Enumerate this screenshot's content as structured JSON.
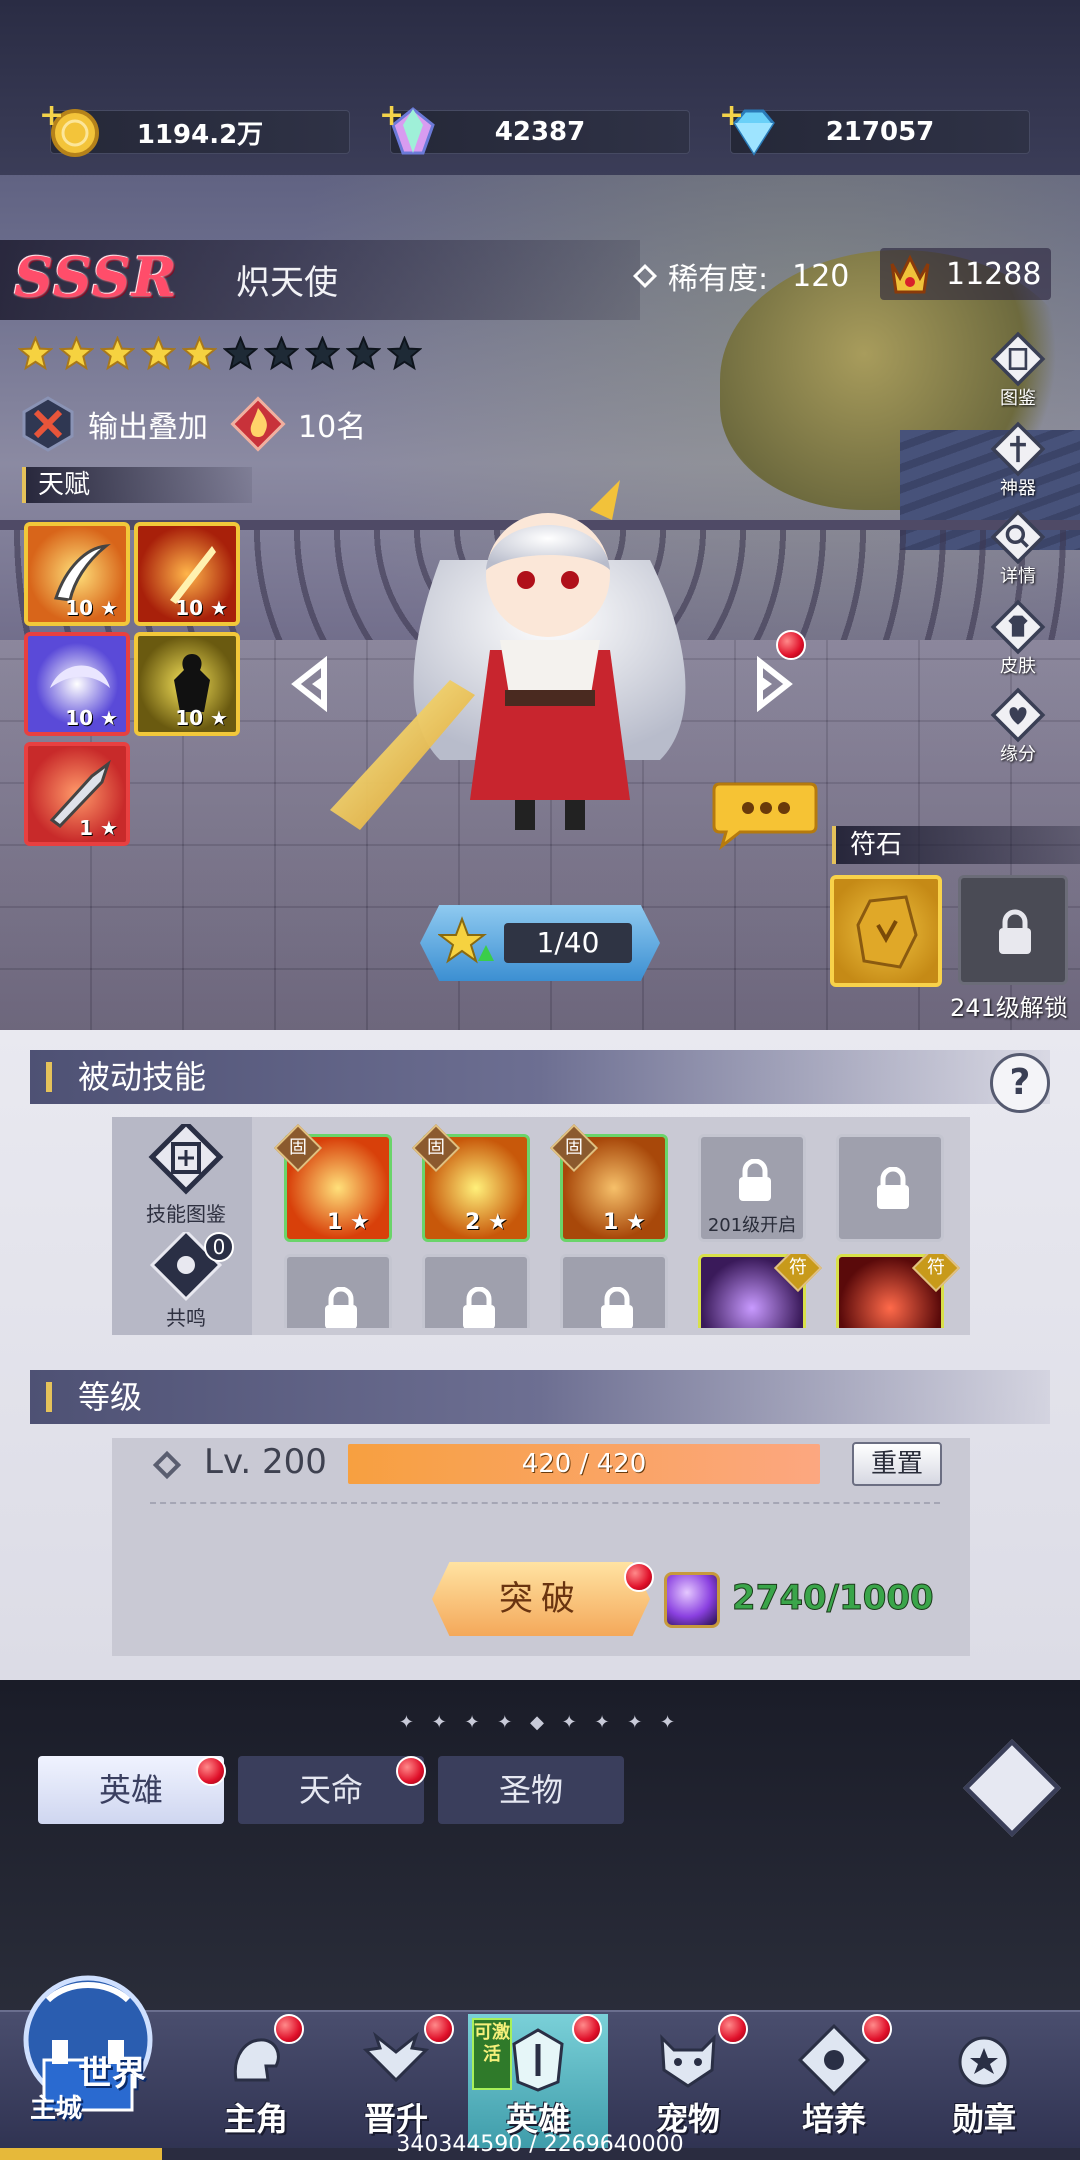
{
  "currencies": [
    {
      "name": "gold",
      "value": "1194.2万",
      "icon": "gold-coin-icon"
    },
    {
      "name": "crystal",
      "value": "42387",
      "icon": "rainbow-crystal-icon"
    },
    {
      "name": "diamond",
      "value": "217057",
      "icon": "blue-diamond-icon"
    }
  ],
  "hero": {
    "tier": "SSSR",
    "name": "炽天使",
    "rarity_label": "稀有度:",
    "rarity_value": "120",
    "power": "11288",
    "stars_filled": 5,
    "stars_total": 10,
    "tags": [
      {
        "icon": "crossed-swords-icon",
        "label": "输出叠加"
      },
      {
        "icon": "flame-icon",
        "label": "10名"
      }
    ],
    "talent_label": "天赋",
    "talents": [
      {
        "icon": "blade-talent-icon",
        "level": "10"
      },
      {
        "icon": "fire-slash-talent-icon",
        "level": "10"
      },
      {
        "icon": "swirl-talent-icon",
        "level": "10"
      },
      {
        "icon": "shadow-talent-icon",
        "level": "10"
      },
      {
        "icon": "weapon-talent-icon",
        "level": "1"
      }
    ],
    "level_progress": "1/40"
  },
  "side_menu": [
    {
      "label": "图鉴",
      "icon": "codex-icon"
    },
    {
      "label": "神器",
      "icon": "artifact-icon"
    },
    {
      "label": "详情",
      "icon": "magnifier-icon"
    },
    {
      "label": "皮肤",
      "icon": "skin-icon"
    },
    {
      "label": "缘分",
      "icon": "heart-icon"
    }
  ],
  "rune": {
    "label": "符石",
    "unlock_text": "241级解锁"
  },
  "passive": {
    "title": "被动技能",
    "codex_label": "技能图鉴",
    "resonance_label": "共鸣",
    "resonance_count": "0",
    "skills_row1": [
      {
        "state": "active",
        "badge": "固",
        "level": "1"
      },
      {
        "state": "active",
        "badge": "固",
        "level": "2"
      },
      {
        "state": "active",
        "badge": "固",
        "level": "1"
      },
      {
        "state": "locked",
        "unlock": "201级开启"
      },
      {
        "state": "locked",
        "unlock": ""
      }
    ],
    "skills_row2": [
      {
        "state": "locked"
      },
      {
        "state": "locked"
      },
      {
        "state": "locked"
      },
      {
        "state": "rune",
        "badge": "符"
      },
      {
        "state": "rune",
        "badge": "符"
      }
    ]
  },
  "level": {
    "title": "等级",
    "lv_text": "Lv. 200",
    "exp_text": "420 / 420",
    "exp_fraction": 1.0,
    "reset_label": "重置",
    "break_label": "突破",
    "orb_count": "2740/1000"
  },
  "sub_tabs": [
    {
      "label": "英雄",
      "active": true
    },
    {
      "label": "天命",
      "active": false
    },
    {
      "label": "圣物",
      "active": false
    }
  ],
  "nav": {
    "world_label": "世界",
    "home_label": "主城",
    "items": [
      {
        "label": "主角",
        "icon": "hero-head-icon",
        "dot": true
      },
      {
        "label": "晋升",
        "icon": "wings-icon",
        "dot": true
      },
      {
        "label": "英雄",
        "icon": "helmet-icon",
        "dot": true,
        "active": true,
        "badge": "可激活"
      },
      {
        "label": "宠物",
        "icon": "pet-icon",
        "dot": true
      },
      {
        "label": "培养",
        "icon": "compass-icon",
        "dot": true
      },
      {
        "label": "勋章",
        "icon": "medal-icon",
        "dot": false
      }
    ]
  },
  "exp_footer": {
    "text": "340344590 / 2269640000",
    "fraction": 0.15
  }
}
